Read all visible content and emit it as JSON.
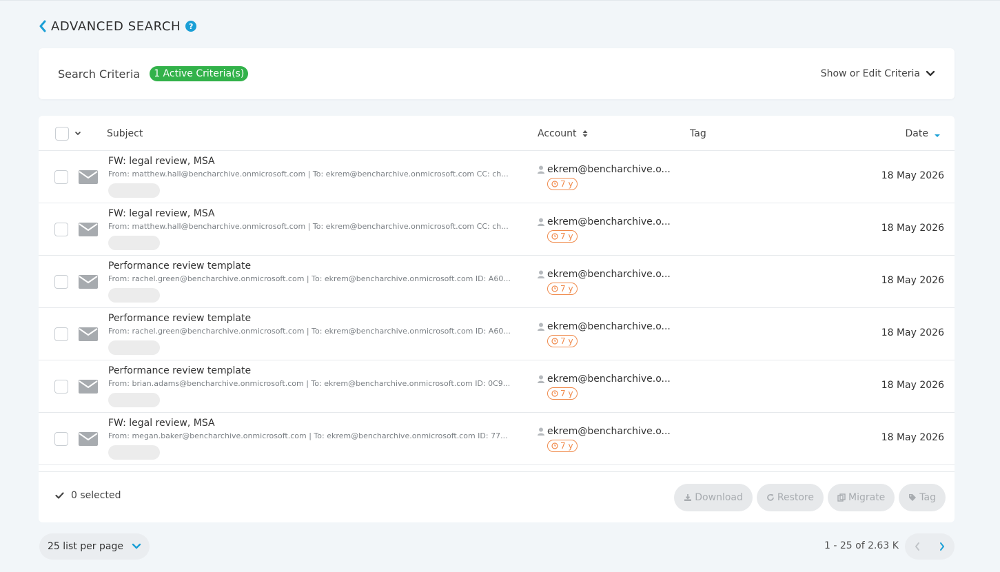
{
  "header": {
    "title": "ADVANCED SEARCH",
    "help_glyph": "?"
  },
  "criteria": {
    "label": "Search Criteria",
    "badge": "1 Active Criteria(s)",
    "toggle_label": "Show or Edit Criteria"
  },
  "table": {
    "columns": {
      "subject": "Subject",
      "account": "Account",
      "tag": "Tag",
      "date": "Date"
    },
    "rows": [
      {
        "subject": "FW: legal review, MSA",
        "meta": "From: matthew.hall@bencharchive.onmicrosoft.com | To: ekrem@bencharchive.onmicrosoft.com CC: ch...",
        "account": "ekrem@bencharchive.o...",
        "retention": "7 y",
        "date": "18 May 2026"
      },
      {
        "subject": "FW: legal review, MSA",
        "meta": "From: matthew.hall@bencharchive.onmicrosoft.com | To: ekrem@bencharchive.onmicrosoft.com CC: ch...",
        "account": "ekrem@bencharchive.o...",
        "retention": "7 y",
        "date": "18 May 2026"
      },
      {
        "subject": "Performance review template",
        "meta": "From: rachel.green@bencharchive.onmicrosoft.com | To: ekrem@bencharchive.onmicrosoft.com ID: A60...",
        "account": "ekrem@bencharchive.o...",
        "retention": "7 y",
        "date": "18 May 2026"
      },
      {
        "subject": "Performance review template",
        "meta": "From: rachel.green@bencharchive.onmicrosoft.com | To: ekrem@bencharchive.onmicrosoft.com ID: A60...",
        "account": "ekrem@bencharchive.o...",
        "retention": "7 y",
        "date": "18 May 2026"
      },
      {
        "subject": "Performance review template",
        "meta": "From: brian.adams@bencharchive.onmicrosoft.com | To: ekrem@bencharchive.onmicrosoft.com ID: 0C9...",
        "account": "ekrem@bencharchive.o...",
        "retention": "7 y",
        "date": "18 May 2026"
      },
      {
        "subject": "FW: legal review, MSA",
        "meta": "From: megan.baker@bencharchive.onmicrosoft.com | To: ekrem@bencharchive.onmicrosoft.com ID: 77...",
        "account": "ekrem@bencharchive.o...",
        "retention": "7 y",
        "date": "18 May 2026"
      }
    ]
  },
  "footer": {
    "selected_text": "0 selected",
    "actions": {
      "download": "Download",
      "restore": "Restore",
      "migrate": "Migrate",
      "tag": "Tag"
    }
  },
  "pagination": {
    "per_page": "25 list per page",
    "range": "1 - 25 of 2.63 K"
  },
  "colors": {
    "accent": "#1a9fd6",
    "badge_green": "#32b24a",
    "retention_orange": "#f08a4b"
  }
}
